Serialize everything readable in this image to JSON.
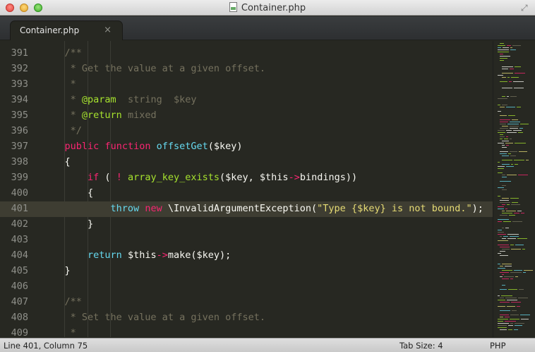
{
  "window": {
    "title": "Container.php"
  },
  "tabs": [
    {
      "label": "Container.php",
      "close": "×"
    }
  ],
  "editor": {
    "active_line": 401,
    "lines": [
      {
        "num": "391",
        "indent": 1,
        "tokens": [
          {
            "t": "/**",
            "c": "comment"
          }
        ]
      },
      {
        "num": "392",
        "indent": 1,
        "tokens": [
          {
            "t": " * Get the value at a given offset.",
            "c": "comment"
          }
        ]
      },
      {
        "num": "393",
        "indent": 1,
        "tokens": [
          {
            "t": " *",
            "c": "comment"
          }
        ]
      },
      {
        "num": "394",
        "indent": 1,
        "tokens": [
          {
            "t": " * ",
            "c": "comment"
          },
          {
            "t": "@param",
            "c": "docparam"
          },
          {
            "t": "  string  $key",
            "c": "comment"
          }
        ]
      },
      {
        "num": "395",
        "indent": 1,
        "tokens": [
          {
            "t": " * ",
            "c": "comment"
          },
          {
            "t": "@return",
            "c": "docparam"
          },
          {
            "t": " mixed",
            "c": "comment"
          }
        ]
      },
      {
        "num": "396",
        "indent": 1,
        "tokens": [
          {
            "t": " */",
            "c": "comment"
          }
        ]
      },
      {
        "num": "397",
        "indent": 1,
        "tokens": [
          {
            "t": "public",
            "c": "storage"
          },
          {
            "t": " ",
            "c": "var"
          },
          {
            "t": "function",
            "c": "storage"
          },
          {
            "t": " ",
            "c": "var"
          },
          {
            "t": "offsetGet",
            "c": "builtin"
          },
          {
            "t": "($key)",
            "c": "var"
          }
        ]
      },
      {
        "num": "398",
        "indent": 1,
        "tokens": [
          {
            "t": "{",
            "c": "var"
          }
        ]
      },
      {
        "num": "399",
        "indent": 2,
        "tokens": [
          {
            "t": "if",
            "c": "kw"
          },
          {
            "t": " ( ",
            "c": "var"
          },
          {
            "t": "!",
            "c": "kw"
          },
          {
            "t": " ",
            "c": "var"
          },
          {
            "t": "array_key_exists",
            "c": "fn"
          },
          {
            "t": "($key, $this",
            "c": "var"
          },
          {
            "t": "->",
            "c": "kw"
          },
          {
            "t": "bindings))",
            "c": "var"
          }
        ]
      },
      {
        "num": "400",
        "indent": 2,
        "tokens": [
          {
            "t": "{",
            "c": "var"
          }
        ]
      },
      {
        "num": "401",
        "indent": 3,
        "tokens": [
          {
            "t": "throw",
            "c": "builtin"
          },
          {
            "t": " ",
            "c": "var"
          },
          {
            "t": "new",
            "c": "kw"
          },
          {
            "t": " \\InvalidArgumentException(",
            "c": "var"
          },
          {
            "t": "\"Type {$key} is not bound.\"",
            "c": "str"
          },
          {
            "t": ");",
            "c": "var"
          }
        ]
      },
      {
        "num": "402",
        "indent": 2,
        "tokens": [
          {
            "t": "}",
            "c": "var"
          }
        ]
      },
      {
        "num": "403",
        "indent": 0,
        "tokens": []
      },
      {
        "num": "404",
        "indent": 2,
        "tokens": [
          {
            "t": "return",
            "c": "builtin"
          },
          {
            "t": " $this",
            "c": "var"
          },
          {
            "t": "->",
            "c": "kw"
          },
          {
            "t": "make($key);",
            "c": "var"
          }
        ]
      },
      {
        "num": "405",
        "indent": 1,
        "tokens": [
          {
            "t": "}",
            "c": "var"
          }
        ]
      },
      {
        "num": "406",
        "indent": 0,
        "tokens": []
      },
      {
        "num": "407",
        "indent": 1,
        "tokens": [
          {
            "t": "/**",
            "c": "comment"
          }
        ]
      },
      {
        "num": "408",
        "indent": 1,
        "tokens": [
          {
            "t": " * Set the value at a given offset.",
            "c": "comment"
          }
        ]
      },
      {
        "num": "409",
        "indent": 1,
        "tokens": [
          {
            "t": " *",
            "c": "comment"
          }
        ]
      }
    ]
  },
  "statusbar": {
    "position": "Line 401, Column 75",
    "tab_size": "Tab Size: 4",
    "syntax": "PHP"
  },
  "colors": {
    "background": "#272822",
    "comment": "#75715e",
    "keyword": "#f92672",
    "function": "#a6e22e",
    "builtin": "#66d9ef",
    "string": "#e6db74"
  },
  "icons": {
    "file": "php-file-icon",
    "fullscreen": "fullscreen-icon"
  }
}
